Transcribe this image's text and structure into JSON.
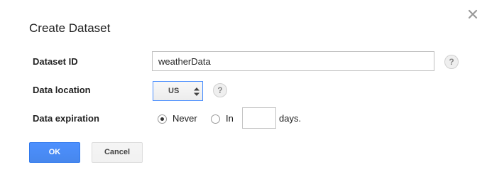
{
  "dialog": {
    "title": "Create Dataset",
    "close_icon": "close-icon"
  },
  "fields": {
    "dataset_id": {
      "label": "Dataset ID",
      "value": "weatherData",
      "help_glyph": "?"
    },
    "data_location": {
      "label": "Data location",
      "selected": "US",
      "help_glyph": "?"
    },
    "data_expiration": {
      "label": "Data expiration",
      "options": [
        {
          "label": "Never",
          "checked": true
        },
        {
          "label": "In",
          "checked": false
        }
      ],
      "days_value": "",
      "days_suffix": "days."
    }
  },
  "buttons": {
    "ok_label": "OK",
    "cancel_label": "Cancel"
  },
  "colors": {
    "primary": "#4d90fe",
    "primary_border": "#3079ed",
    "focus_border": "#4d90fe"
  }
}
